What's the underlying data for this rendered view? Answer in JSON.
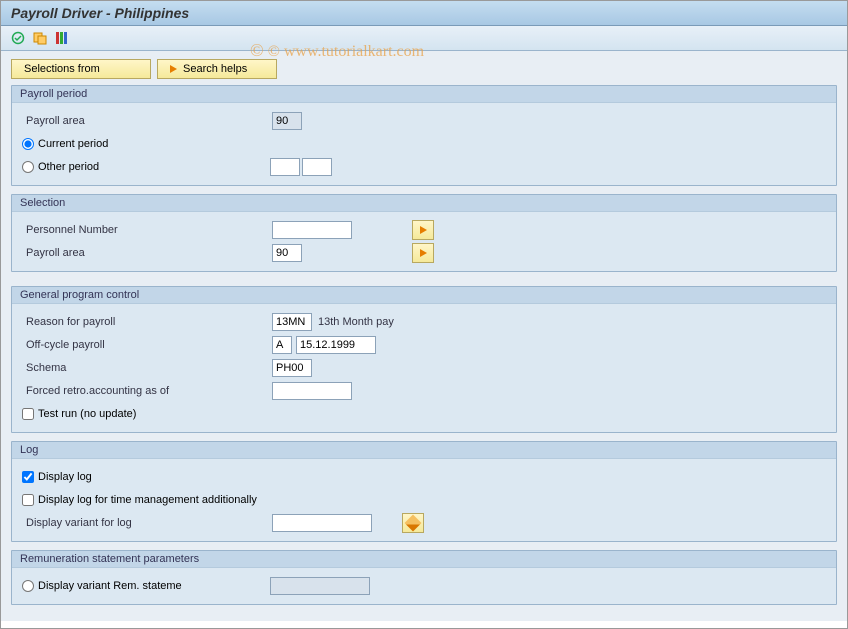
{
  "title": "Payroll Driver - Philippines",
  "watermark": "© www.tutorialkart.com",
  "buttons": {
    "selections_from": "Selections from",
    "search_helps": "Search helps"
  },
  "payroll_period": {
    "title": "Payroll period",
    "area_label": "Payroll area",
    "area_value": "90",
    "current_label": "Current period",
    "other_label": "Other period",
    "other_v1": "",
    "other_v2": ""
  },
  "selection": {
    "title": "Selection",
    "pernr_label": "Personnel Number",
    "pernr_value": "",
    "area_label": "Payroll area",
    "area_value": "90"
  },
  "gpc": {
    "title": "General program control",
    "reason_label": "Reason for payroll",
    "reason_code": "13MN",
    "reason_text": "13th Month pay",
    "offcycle_label": "Off-cycle payroll",
    "offcycle_code": "A",
    "offcycle_date": "15.12.1999",
    "schema_label": "Schema",
    "schema_value": "PH00",
    "retro_label": "Forced retro.accounting as of",
    "retro_value": "",
    "testrun_label": "Test run (no update)"
  },
  "log": {
    "title": "Log",
    "display_label": "Display log",
    "time_label": "Display log for time management additionally",
    "variant_label": "Display variant for log",
    "variant_value": ""
  },
  "rem": {
    "title": "Remuneration statement parameters",
    "variant_label": "Display variant Rem. stateme",
    "variant_value": ""
  }
}
